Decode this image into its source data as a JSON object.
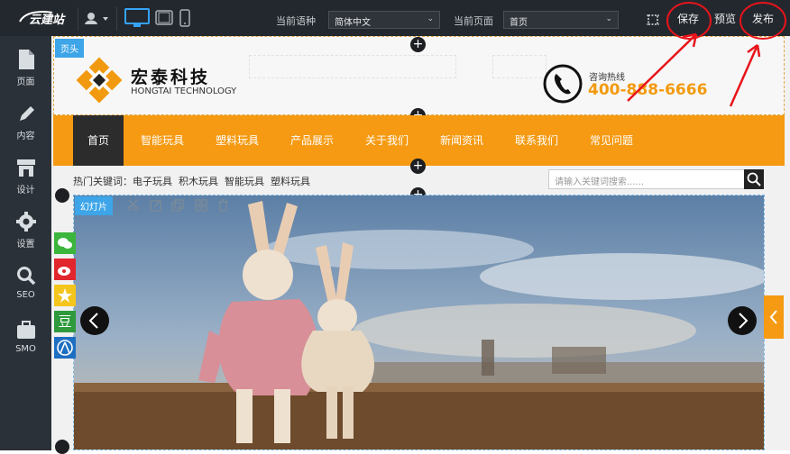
{
  "topbar": {
    "logo_text": "云建站",
    "language_label": "当前语种",
    "language_value": "简体中文",
    "page_label": "当前页面",
    "page_value": "首页",
    "save_label": "保存",
    "preview_label": "预览",
    "publish_label": "发布"
  },
  "sidebar": {
    "items": [
      {
        "label": "页面",
        "icon": "page-icon"
      },
      {
        "label": "内容",
        "icon": "pencil-icon"
      },
      {
        "label": "设计",
        "icon": "store-icon"
      },
      {
        "label": "设置",
        "icon": "gear-icon"
      },
      {
        "label": "SEO",
        "icon": "search-icon"
      },
      {
        "label": "SMO",
        "icon": "briefcase-icon"
      }
    ]
  },
  "header": {
    "tag": "页头",
    "brand_cn": "宏泰科技",
    "brand_en": "HONGTAI TECHNOLOGY",
    "hotline_label": "咨询热线",
    "hotline_number": "400-888-6666"
  },
  "nav": {
    "items": [
      "首页",
      "智能玩具",
      "塑料玩具",
      "产品展示",
      "关于我们",
      "新闻资讯",
      "联系我们",
      "常见问题"
    ]
  },
  "keywords": {
    "label": "热门关键词：",
    "items": [
      "电子玩具",
      "积木玩具",
      "智能玩具",
      "塑料玩具"
    ]
  },
  "search": {
    "placeholder": "请输入关键词搜索......"
  },
  "banner": {
    "tag": "幻灯片"
  },
  "colors": {
    "accent": "#f59a12",
    "topbar": "#23282e",
    "annotation": "#e8141b"
  }
}
